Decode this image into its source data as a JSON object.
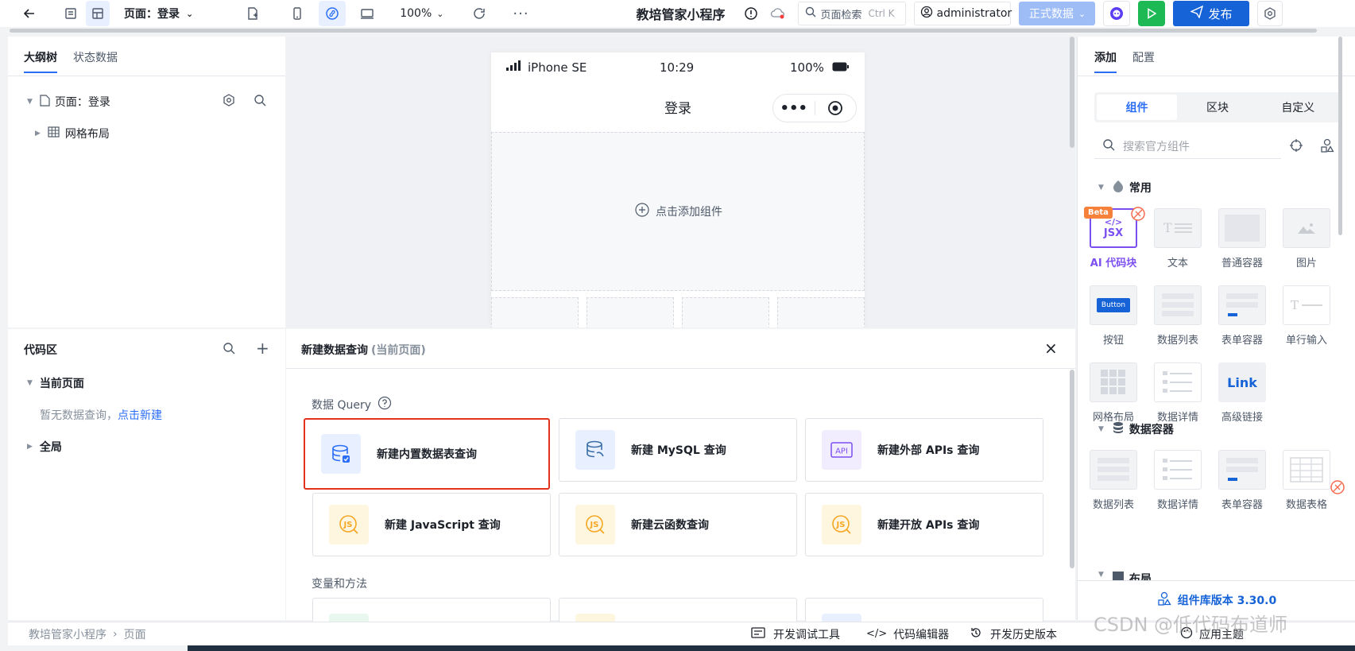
{
  "topbar": {
    "page_label": "页面：登录",
    "zoom": "100%",
    "app_title": "教培管家小程序",
    "search_placeholder": "页面检索",
    "search_shortcut": "Ctrl K",
    "user": "administrator",
    "data_env": "正式数据",
    "publish": "发布"
  },
  "left": {
    "tabs": [
      "大纲树",
      "状态数据"
    ],
    "tree": [
      {
        "label": "页面：登录"
      },
      {
        "label": "网格布局"
      }
    ]
  },
  "phone": {
    "carrier": "iPhone SE",
    "time": "10:29",
    "battery": "100%",
    "title": "登录",
    "placeholder": "点击添加组件"
  },
  "code": {
    "title": "代码区",
    "current_page": "当前页面",
    "empty_text": "暂无数据查询，",
    "new_link": "点击新建",
    "global": "全局"
  },
  "query": {
    "title": "新建数据查询",
    "subtitle": "(当前页面)",
    "section_label": "数据 Query",
    "section2_label": "变量和方法",
    "cards": [
      {
        "label": "新建内置数据表查询"
      },
      {
        "label": "新建 MySQL 查询"
      },
      {
        "label": "新建外部 APIs 查询"
      },
      {
        "label": "新建 JavaScript 查询"
      },
      {
        "label": "新建云函数查询"
      },
      {
        "label": "新建开放 APIs 查询"
      }
    ]
  },
  "right": {
    "tabs": [
      "添加",
      "配置"
    ],
    "seg": [
      "组件",
      "区块",
      "自定义"
    ],
    "search_placeholder": "搜索官方组件",
    "group1": "常用",
    "group2": "数据容器",
    "group3": "布局",
    "beta": "Beta",
    "jsx": "JSX",
    "button_thumb": "Button",
    "link_thumb": "Link",
    "common": [
      "AI 代码块",
      "文本",
      "普通容器",
      "图片",
      "按钮",
      "数据列表",
      "表单容器",
      "单行输入",
      "网格布局",
      "数据详情",
      "高级链接"
    ],
    "containers": [
      "数据列表",
      "数据详情",
      "表单容器",
      "数据表格"
    ],
    "lib_version": "组件库版本 3.30.0",
    "apply_theme": "应用主题"
  },
  "footer": {
    "breadcrumb": [
      "教培管家小程序",
      "页面"
    ],
    "debug": "开发调试工具",
    "editor": "代码编辑器",
    "history": "开发历史版本"
  },
  "watermark": "CSDN @低代码布道师",
  "colors": {
    "accent": "#2b6ef5",
    "publish": "#1663d8",
    "run": "#1db954",
    "selected_border": "#e2311c"
  }
}
